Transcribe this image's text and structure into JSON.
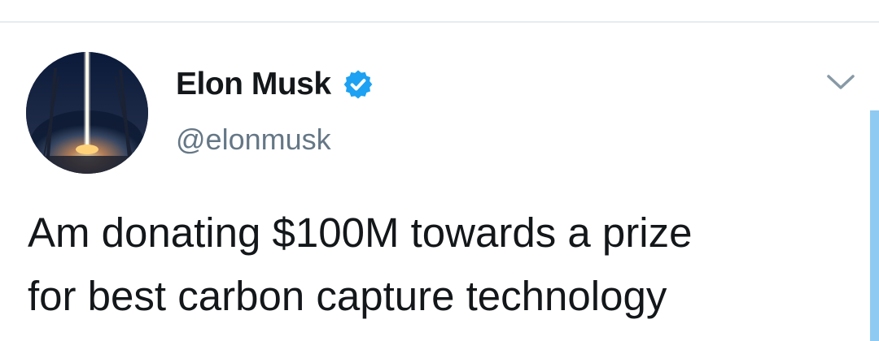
{
  "tweet": {
    "display_name": "Elon Musk",
    "handle": "@elonmusk",
    "text": "Am donating $100M towards a prize\nfor best carbon capture technology",
    "verified": true
  },
  "icons": {
    "verified": "verified-badge-icon",
    "menu": "chevron-down-icon",
    "avatar": "rocket-launch-avatar"
  },
  "colors": {
    "accent": "#1da1f2",
    "text_primary": "#14171a",
    "text_secondary": "#657786",
    "divider": "#e6ecf0",
    "scroll_indicator": "#8fcaf2"
  }
}
